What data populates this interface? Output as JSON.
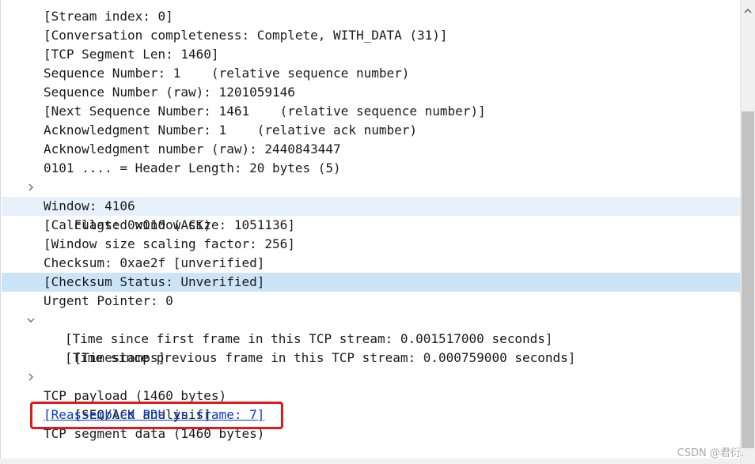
{
  "tree": {
    "rows": [
      "[Stream index: 0]",
      "[Conversation completeness: Complete, WITH_DATA (31)]",
      "[TCP Segment Len: 1460]",
      "Sequence Number: 1    (relative sequence number)",
      "Sequence Number (raw): 1201059146",
      "[Next Sequence Number: 1461    (relative sequence number)]",
      "Acknowledgment Number: 1    (relative ack number)",
      "Acknowledgment number (raw): 2440843447",
      "0101 .... = Header Length: 20 bytes (5)",
      "Flags: 0x010 (ACK)",
      "Window: 4106",
      "[Calculated window size: 1051136]",
      "[Window size scaling factor: 256]",
      "Checksum: 0xae2f [unverified]",
      "[Checksum Status: Unverified]",
      "Urgent Pointer: 0",
      "[Timestamps]",
      "[Time since first frame in this TCP stream: 0.001517000 seconds]",
      "[Time since previous frame in this TCP stream: 0.000759000 seconds]",
      "[SEQ/ACK analysis]",
      "TCP payload (1460 bytes)",
      "[Reassembled PDU in frame: 7]",
      "TCP segment data (1460 bytes)"
    ]
  },
  "watermark": "CSDN @君衍.",
  "colors": {
    "highlight_light": "#e6f1fb",
    "highlight_selected": "#cce4f7",
    "link": "#0b3ec8",
    "annotation_box": "#e0191c"
  },
  "icons": {
    "collapsed": "chevron-right-icon",
    "expanded": "chevron-down-icon",
    "scroll_up": "scroll-up-arrow-icon"
  }
}
